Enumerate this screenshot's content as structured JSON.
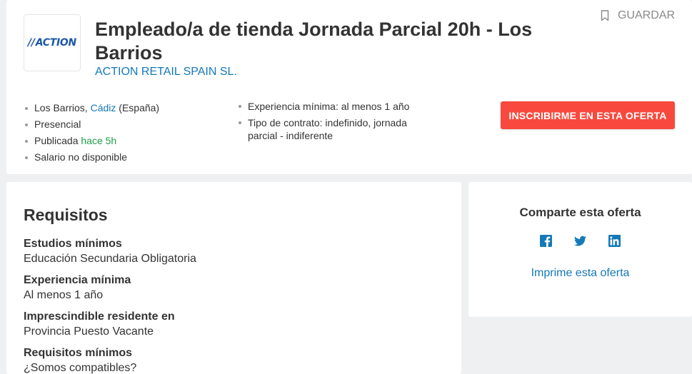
{
  "header": {
    "logo_text": "ACTION",
    "title": "Empleado/a de tienda Jornada Parcial 20h - Los Barrios",
    "company": "ACTION RETAIL SPAIN SL.",
    "save_label": "GUARDAR",
    "apply_label": "INSCRIBIRME EN ESTA OFERTA",
    "location_city": "Los Barrios, ",
    "location_province": "Cádiz",
    "location_country": " (España)",
    "modality": "Presencial",
    "published_prefix": "Publicada ",
    "published_time": "hace 5h",
    "salary": "Salario no disponible",
    "experience": "Experiencia mínima: al menos 1 año",
    "contract": "Tipo de contrato: indefinido, jornada parcial - indiferente"
  },
  "requirements": {
    "title": "Requisitos",
    "items": [
      {
        "label": "Estudios mínimos",
        "value": "Educación Secundaria Obligatoria"
      },
      {
        "label": "Experiencia mínima",
        "value": "Al menos 1 año"
      },
      {
        "label": "Imprescindible residente en",
        "value": "Provincia Puesto Vacante"
      },
      {
        "label": "Requisitos mínimos",
        "value": "¿Somos compatibles?"
      }
    ]
  },
  "share": {
    "title": "Comparte esta oferta",
    "icons": [
      "facebook-icon",
      "twitter-icon",
      "linkedin-icon"
    ],
    "print_label": "Imprime esta oferta"
  },
  "colors": {
    "accent": "#f8493e",
    "link": "#1479b8",
    "published": "#1e9e4a",
    "logo": "#1a58a8"
  }
}
